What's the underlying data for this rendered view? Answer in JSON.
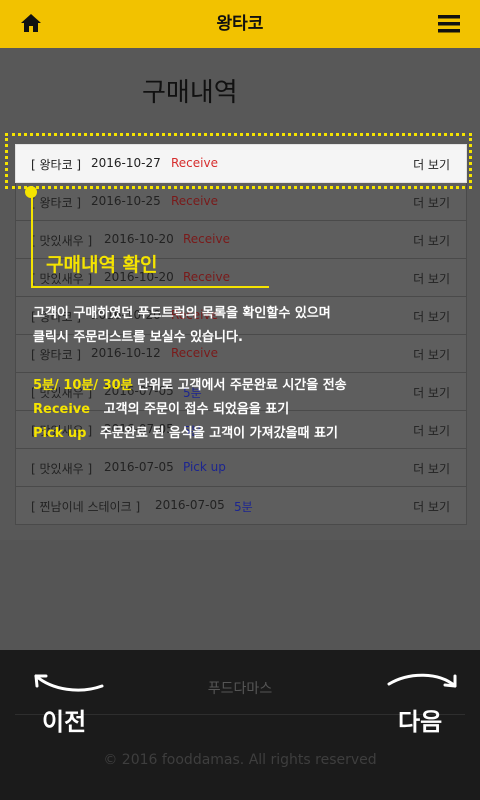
{
  "header": {
    "title": "왕타코",
    "home_icon": "home-icon",
    "menu_icon": "hamburger-menu-icon",
    "bg_color": "#f2c200"
  },
  "page": {
    "title": "구매내역"
  },
  "orders": [
    {
      "store": "[ 왕타코 ]",
      "date": "2016-10-27",
      "status": "Receive",
      "status_type": "receive",
      "more": "더 보기"
    },
    {
      "store": "[ 왕타코 ]",
      "date": "2016-10-25",
      "status": "Receive",
      "status_type": "receive",
      "more": "더 보기"
    },
    {
      "store": "[ 맛있새우 ]",
      "date": "2016-10-20",
      "status": "Receive",
      "status_type": "receive",
      "more": "더 보기"
    },
    {
      "store": "[ 맛있새우 ]",
      "date": "2016-10-20",
      "status": "Receive",
      "status_type": "receive",
      "more": "더 보기"
    },
    {
      "store": "[ 왕타코 ]",
      "date": "2016-10-20",
      "status": "Receive",
      "status_type": "receive",
      "more": "더 보기"
    },
    {
      "store": "[ 왕타코 ]",
      "date": "2016-10-12",
      "status": "Receive",
      "status_type": "receive",
      "more": "더 보기"
    },
    {
      "store": "[ 맛있새우 ]",
      "date": "2016-07-05",
      "status": "5분",
      "status_type": "min",
      "more": "더 보기"
    },
    {
      "store": "[ 맛있새우 ]",
      "date": "2016-07-05",
      "status": "5분",
      "status_type": "min",
      "more": "더 보기"
    },
    {
      "store": "[ 맛있새우 ]",
      "date": "2016-07-05",
      "status": "Pick up",
      "status_type": "pickup",
      "more": "더 보기"
    },
    {
      "store": "[ 찐남이네 스테이크 ]",
      "date": "2016-07-05",
      "status": "5분",
      "status_type": "min",
      "more": "더 보기"
    }
  ],
  "annotation": {
    "title": "구매내역 확인",
    "line1": "고객이 구매하였던 푸드트럭의 목록을 확인할수 있으며",
    "line2": "클릭시 주문리스트를 보실수 있습니다.",
    "legend": [
      {
        "key": "5분/ 10분/ 30분",
        "desc": " 단위로 고객에서 주문완료 시간을 전송"
      },
      {
        "key": "Receive",
        "desc": "   고객의 주문이 접수 되었음을 표기"
      },
      {
        "key": "Pick up",
        "desc": "   주문완료 된 음식을 고객이 가져갔을때 표기"
      }
    ],
    "accent_color": "#f5e400"
  },
  "footer": {
    "brand": "푸드다마스",
    "copyright": "© 2016 fooddamas. All rights reserved",
    "prev_label": "이전",
    "next_label": "다음"
  }
}
